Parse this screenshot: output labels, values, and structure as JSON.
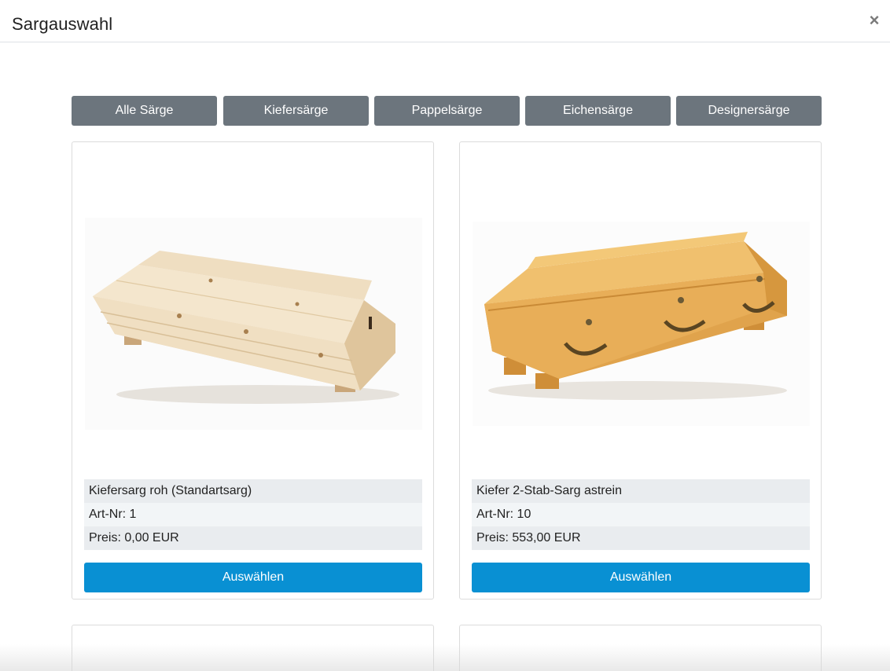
{
  "modal": {
    "title": "Sargauswahl",
    "close_label": "×"
  },
  "filters": [
    {
      "label": "Alle Särge"
    },
    {
      "label": "Kiefersärge"
    },
    {
      "label": "Pappelsärge"
    },
    {
      "label": "Eichensärge"
    },
    {
      "label": "Designersärge"
    }
  ],
  "products": [
    {
      "name": "Kiefersarg roh (Standartsarg)",
      "art_nr": "Art-Nr: 1",
      "price": "Preis: 0,00 EUR",
      "button": "Auswählen",
      "image": "raw-pine-coffin",
      "wood_color": "#ecd9b8"
    },
    {
      "name": "Kiefer 2-Stab-Sarg astrein",
      "art_nr": "Art-Nr: 10",
      "price": "Preis: 553,00 EUR",
      "button": "Auswählen",
      "image": "varnished-pine-coffin",
      "wood_color": "#e3a84c"
    }
  ],
  "colors": {
    "filter_bg": "#6c757d",
    "primary": "#0990d3",
    "row_odd": "#e9ecef",
    "row_even": "#f2f5f7"
  }
}
